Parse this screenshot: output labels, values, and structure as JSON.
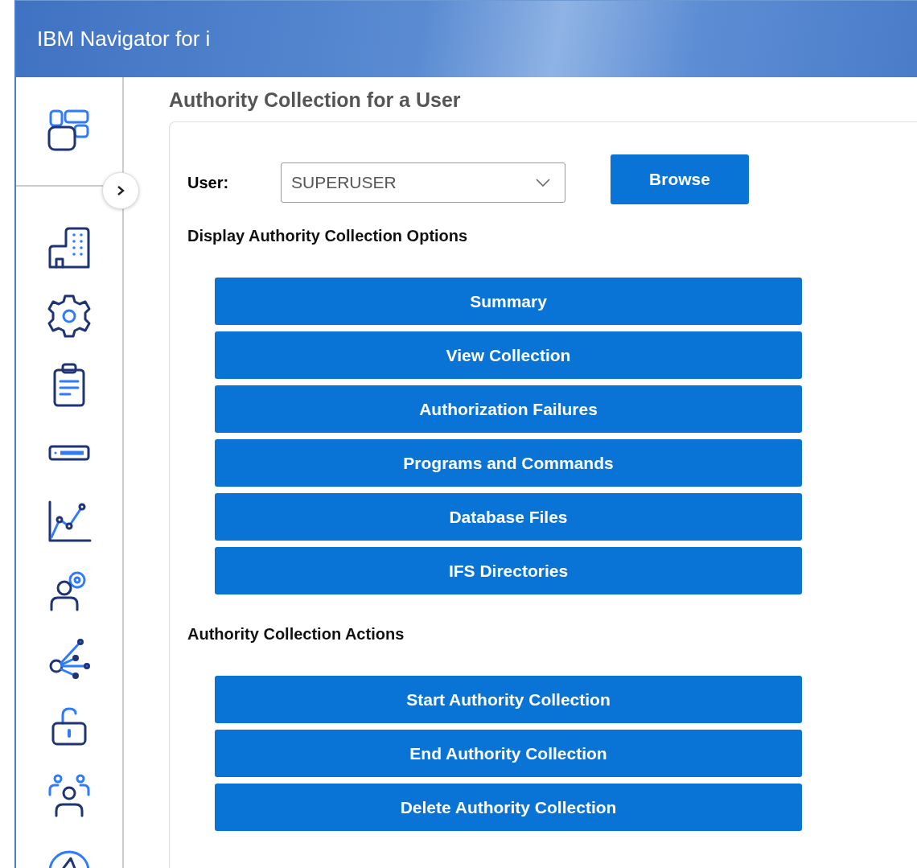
{
  "header": {
    "title": "IBM Navigator for i"
  },
  "page_title": "Authority Collection for a User",
  "user": {
    "label": "User:",
    "value": "SUPERUSER"
  },
  "browse_button": "Browse",
  "sections": [
    {
      "heading": "Display Authority Collection Options",
      "buttons": [
        "Summary",
        "View Collection",
        "Authorization Failures",
        "Programs and Commands",
        "Database Files",
        "IFS Directories"
      ]
    },
    {
      "heading": "Authority Collection Actions",
      "buttons": [
        "Start Authority Collection",
        "End Authority Collection",
        "Delete Authority Collection"
      ]
    }
  ]
}
